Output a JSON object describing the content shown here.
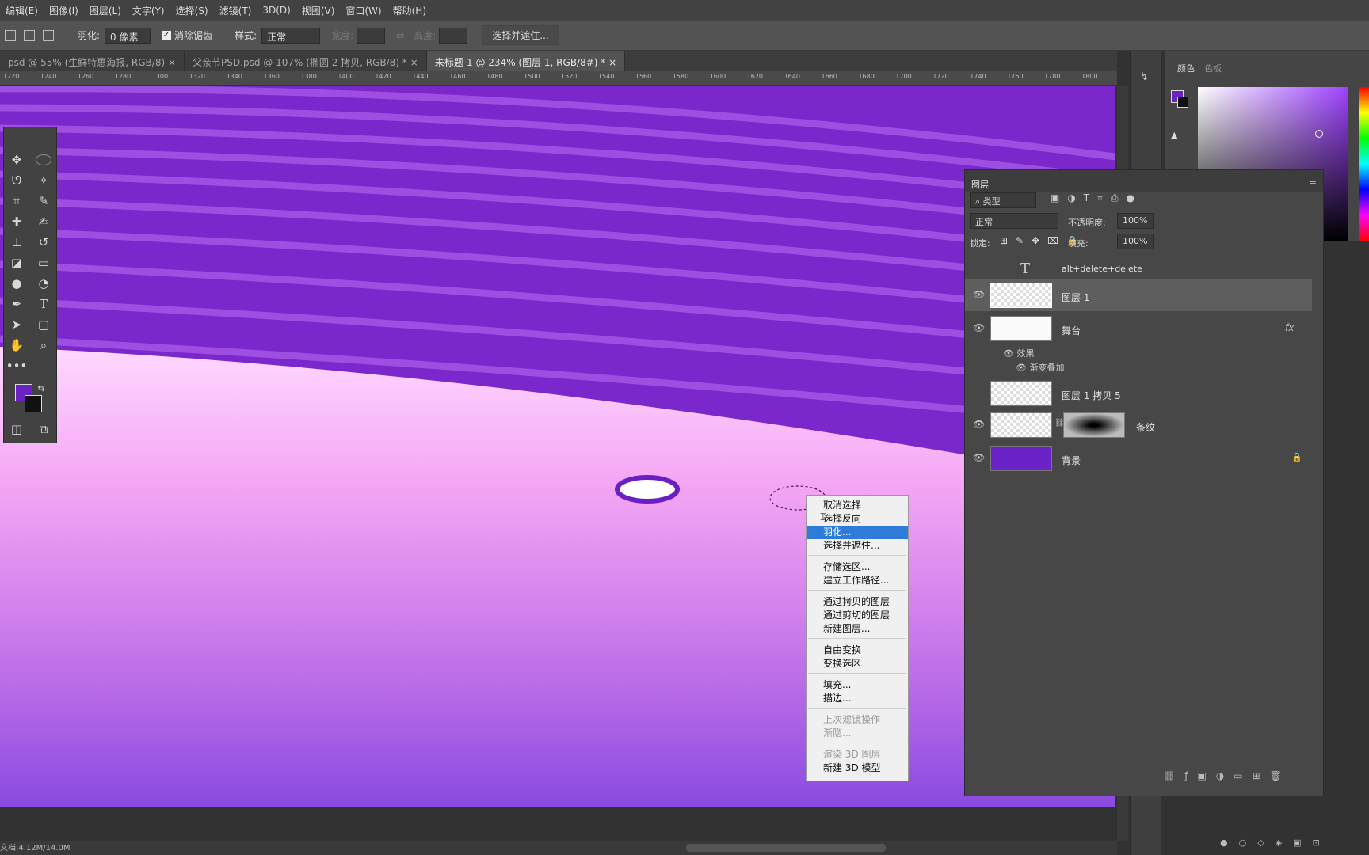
{
  "menubar": {
    "items": [
      "编辑(E)",
      "图像(I)",
      "图层(L)",
      "文字(Y)",
      "选择(S)",
      "滤镜(T)",
      "3D(D)",
      "视图(V)",
      "窗口(W)",
      "帮助(H)"
    ]
  },
  "options": {
    "feather_label": "羽化:",
    "feather_value": "0 像素",
    "antialias_label": "消除锯齿",
    "style_label": "样式:",
    "style_value": "正常",
    "width_label": "宽度:",
    "height_label": "高度:",
    "select_mask_button": "选择并遮住..."
  },
  "tabs": [
    {
      "label": "psd @ 55% (生鲜特惠海报, RGB/8)",
      "close": "×",
      "active": false
    },
    {
      "label": "父亲节PSD.psd @ 107% (椭圆 2 拷贝, RGB/8) *",
      "close": "×",
      "active": false
    },
    {
      "label": "未标题-1 @ 234% (图层 1, RGB/8#) *",
      "close": "×",
      "active": true
    }
  ],
  "ruler": {
    "ticks": [
      "1220",
      "1240",
      "1260",
      "1280",
      "1300",
      "1320",
      "1340",
      "1360",
      "1380",
      "1400",
      "1420",
      "1440",
      "1460",
      "1480",
      "1500",
      "1520",
      "1540",
      "1560",
      "1580",
      "1600",
      "1620",
      "1640",
      "1660",
      "1680",
      "1700",
      "1720",
      "1740",
      "1760",
      "1780",
      "1800"
    ]
  },
  "status": {
    "doc": "文档:4.12M/14.0M"
  },
  "context_menu": {
    "items": [
      {
        "label": "取消选择",
        "state": "normal"
      },
      {
        "label": "选择反向",
        "state": "normal"
      },
      {
        "label": "羽化...",
        "state": "highlighted"
      },
      {
        "label": "选择并遮住...",
        "state": "normal"
      },
      {
        "label": "存储选区...",
        "state": "normal"
      },
      {
        "label": "建立工作路径...",
        "state": "normal"
      },
      {
        "label": "通过拷贝的图层",
        "state": "normal"
      },
      {
        "label": "通过剪切的图层",
        "state": "normal"
      },
      {
        "label": "新建图层...",
        "state": "normal"
      },
      {
        "label": "自由变换",
        "state": "normal"
      },
      {
        "label": "变换选区",
        "state": "normal"
      },
      {
        "label": "填充...",
        "state": "normal"
      },
      {
        "label": "描边...",
        "state": "normal"
      },
      {
        "label": "上次滤镜操作",
        "state": "disabled"
      },
      {
        "label": "渐隐...",
        "state": "disabled"
      },
      {
        "label": "渲染 3D 图层",
        "state": "disabled"
      },
      {
        "label": "新建 3D 模型",
        "state": "normal"
      }
    ]
  },
  "color_panel": {
    "tabs": [
      "颜色",
      "色板"
    ],
    "foreground": "#6b22c4",
    "background": "#111111"
  },
  "layers_panel": {
    "title": "图层",
    "filter_label": "类型",
    "blend_mode": "正常",
    "opacity_label": "不透明度:",
    "opacity_value": "100%",
    "lock_label": "锁定:",
    "fill_label": "填充:",
    "fill_value": "100%",
    "layers": [
      {
        "name": "alt+delete+delete",
        "kind": "text",
        "visible": false,
        "selected": false
      },
      {
        "name": "图层 1",
        "kind": "pixel",
        "visible": true,
        "selected": true
      },
      {
        "name": "舞台",
        "kind": "pixel",
        "visible": true,
        "selected": false,
        "fx": "fx"
      },
      {
        "name": "图层 1 拷贝 5",
        "kind": "pixel",
        "visible": false,
        "selected": false
      },
      {
        "name": "条纹",
        "kind": "masked",
        "visible": true,
        "selected": false
      },
      {
        "name": "背景",
        "kind": "fill",
        "visible": true,
        "selected": false,
        "color": "#6a23c6"
      }
    ],
    "effects_label": "效果",
    "effect_item": "渐变叠加"
  },
  "colors": {
    "accent": "#2f7bd8",
    "purple_dark": "#6a1fc4",
    "purple_light": "#9a45e0",
    "pink": "#f9c8ff"
  }
}
